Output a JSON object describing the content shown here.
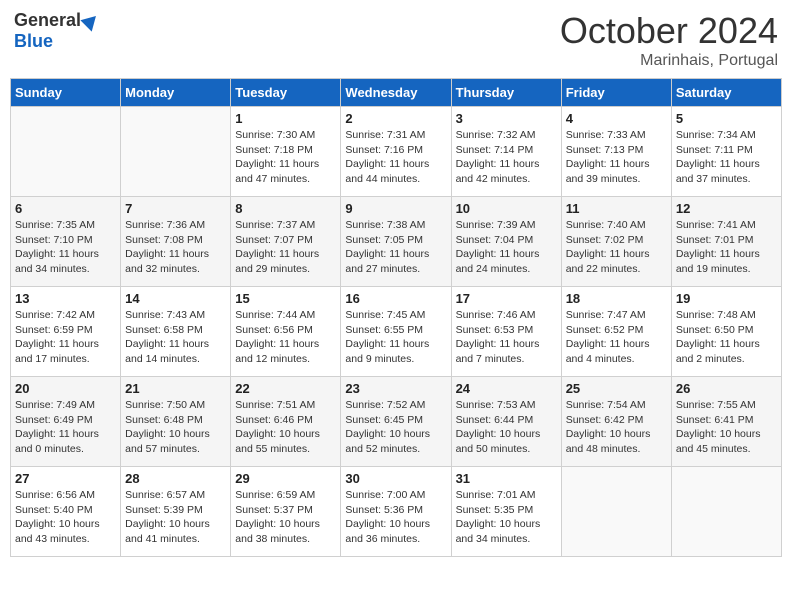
{
  "header": {
    "logo_general": "General",
    "logo_blue": "Blue",
    "month_title": "October 2024",
    "location": "Marinhais, Portugal"
  },
  "weekdays": [
    "Sunday",
    "Monday",
    "Tuesday",
    "Wednesday",
    "Thursday",
    "Friday",
    "Saturday"
  ],
  "weeks": [
    [
      {
        "day": "",
        "info": ""
      },
      {
        "day": "",
        "info": ""
      },
      {
        "day": "1",
        "info": "Sunrise: 7:30 AM\nSunset: 7:18 PM\nDaylight: 11 hours and 47 minutes."
      },
      {
        "day": "2",
        "info": "Sunrise: 7:31 AM\nSunset: 7:16 PM\nDaylight: 11 hours and 44 minutes."
      },
      {
        "day": "3",
        "info": "Sunrise: 7:32 AM\nSunset: 7:14 PM\nDaylight: 11 hours and 42 minutes."
      },
      {
        "day": "4",
        "info": "Sunrise: 7:33 AM\nSunset: 7:13 PM\nDaylight: 11 hours and 39 minutes."
      },
      {
        "day": "5",
        "info": "Sunrise: 7:34 AM\nSunset: 7:11 PM\nDaylight: 11 hours and 37 minutes."
      }
    ],
    [
      {
        "day": "6",
        "info": "Sunrise: 7:35 AM\nSunset: 7:10 PM\nDaylight: 11 hours and 34 minutes."
      },
      {
        "day": "7",
        "info": "Sunrise: 7:36 AM\nSunset: 7:08 PM\nDaylight: 11 hours and 32 minutes."
      },
      {
        "day": "8",
        "info": "Sunrise: 7:37 AM\nSunset: 7:07 PM\nDaylight: 11 hours and 29 minutes."
      },
      {
        "day": "9",
        "info": "Sunrise: 7:38 AM\nSunset: 7:05 PM\nDaylight: 11 hours and 27 minutes."
      },
      {
        "day": "10",
        "info": "Sunrise: 7:39 AM\nSunset: 7:04 PM\nDaylight: 11 hours and 24 minutes."
      },
      {
        "day": "11",
        "info": "Sunrise: 7:40 AM\nSunset: 7:02 PM\nDaylight: 11 hours and 22 minutes."
      },
      {
        "day": "12",
        "info": "Sunrise: 7:41 AM\nSunset: 7:01 PM\nDaylight: 11 hours and 19 minutes."
      }
    ],
    [
      {
        "day": "13",
        "info": "Sunrise: 7:42 AM\nSunset: 6:59 PM\nDaylight: 11 hours and 17 minutes."
      },
      {
        "day": "14",
        "info": "Sunrise: 7:43 AM\nSunset: 6:58 PM\nDaylight: 11 hours and 14 minutes."
      },
      {
        "day": "15",
        "info": "Sunrise: 7:44 AM\nSunset: 6:56 PM\nDaylight: 11 hours and 12 minutes."
      },
      {
        "day": "16",
        "info": "Sunrise: 7:45 AM\nSunset: 6:55 PM\nDaylight: 11 hours and 9 minutes."
      },
      {
        "day": "17",
        "info": "Sunrise: 7:46 AM\nSunset: 6:53 PM\nDaylight: 11 hours and 7 minutes."
      },
      {
        "day": "18",
        "info": "Sunrise: 7:47 AM\nSunset: 6:52 PM\nDaylight: 11 hours and 4 minutes."
      },
      {
        "day": "19",
        "info": "Sunrise: 7:48 AM\nSunset: 6:50 PM\nDaylight: 11 hours and 2 minutes."
      }
    ],
    [
      {
        "day": "20",
        "info": "Sunrise: 7:49 AM\nSunset: 6:49 PM\nDaylight: 11 hours and 0 minutes."
      },
      {
        "day": "21",
        "info": "Sunrise: 7:50 AM\nSunset: 6:48 PM\nDaylight: 10 hours and 57 minutes."
      },
      {
        "day": "22",
        "info": "Sunrise: 7:51 AM\nSunset: 6:46 PM\nDaylight: 10 hours and 55 minutes."
      },
      {
        "day": "23",
        "info": "Sunrise: 7:52 AM\nSunset: 6:45 PM\nDaylight: 10 hours and 52 minutes."
      },
      {
        "day": "24",
        "info": "Sunrise: 7:53 AM\nSunset: 6:44 PM\nDaylight: 10 hours and 50 minutes."
      },
      {
        "day": "25",
        "info": "Sunrise: 7:54 AM\nSunset: 6:42 PM\nDaylight: 10 hours and 48 minutes."
      },
      {
        "day": "26",
        "info": "Sunrise: 7:55 AM\nSunset: 6:41 PM\nDaylight: 10 hours and 45 minutes."
      }
    ],
    [
      {
        "day": "27",
        "info": "Sunrise: 6:56 AM\nSunset: 5:40 PM\nDaylight: 10 hours and 43 minutes."
      },
      {
        "day": "28",
        "info": "Sunrise: 6:57 AM\nSunset: 5:39 PM\nDaylight: 10 hours and 41 minutes."
      },
      {
        "day": "29",
        "info": "Sunrise: 6:59 AM\nSunset: 5:37 PM\nDaylight: 10 hours and 38 minutes."
      },
      {
        "day": "30",
        "info": "Sunrise: 7:00 AM\nSunset: 5:36 PM\nDaylight: 10 hours and 36 minutes."
      },
      {
        "day": "31",
        "info": "Sunrise: 7:01 AM\nSunset: 5:35 PM\nDaylight: 10 hours and 34 minutes."
      },
      {
        "day": "",
        "info": ""
      },
      {
        "day": "",
        "info": ""
      }
    ]
  ]
}
